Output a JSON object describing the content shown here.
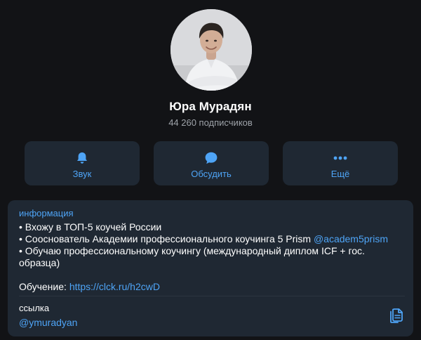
{
  "profile": {
    "name": "Юра Мурадян",
    "subscribers": "44 260 подписчиков",
    "avatar_icon": "user-photo"
  },
  "actions": [
    {
      "label": "Звук",
      "icon": "bell-icon"
    },
    {
      "label": "Обсудить",
      "icon": "chat-bubble-icon"
    },
    {
      "label": "Ещё",
      "icon": "more-dots-icon"
    }
  ],
  "info": {
    "header": "информация",
    "bullet1": "• Вхожу в ТОП-5 коучей России",
    "bullet2_text": "• Сооснователь Академии профессионального коучинга 5 Prism ",
    "bullet2_mention": "@academ5prism",
    "bullet3": "• Обучаю профессиональному коучингу (международный диплом ICF + гос. образца)",
    "training_label": "Обучение: ",
    "training_link": "https://clck.ru/h2cwD",
    "link_label": "ссылка",
    "link_value": "@ymuradyan"
  },
  "colors": {
    "background": "#121316",
    "card": "#1f2833",
    "accent": "#4ea4f6",
    "muted": "#9ea3a9"
  }
}
